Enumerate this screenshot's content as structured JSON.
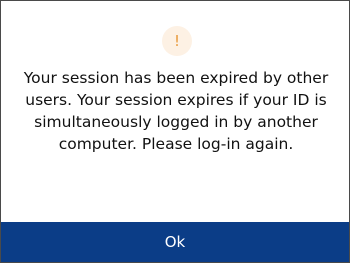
{
  "dialog": {
    "icon": "warning-exclamation-icon",
    "icon_glyph": "!",
    "message": "Your session has been expired by other users. Your session expires if your ID is simultaneously logged in by another computer. Please log-in again.",
    "ok_label": "Ok"
  },
  "colors": {
    "accent": "#0b3d87",
    "warning": "#e89a3c",
    "warning_background": "#fdf1e4",
    "border": "#4a4a4a",
    "text": "#111111"
  }
}
